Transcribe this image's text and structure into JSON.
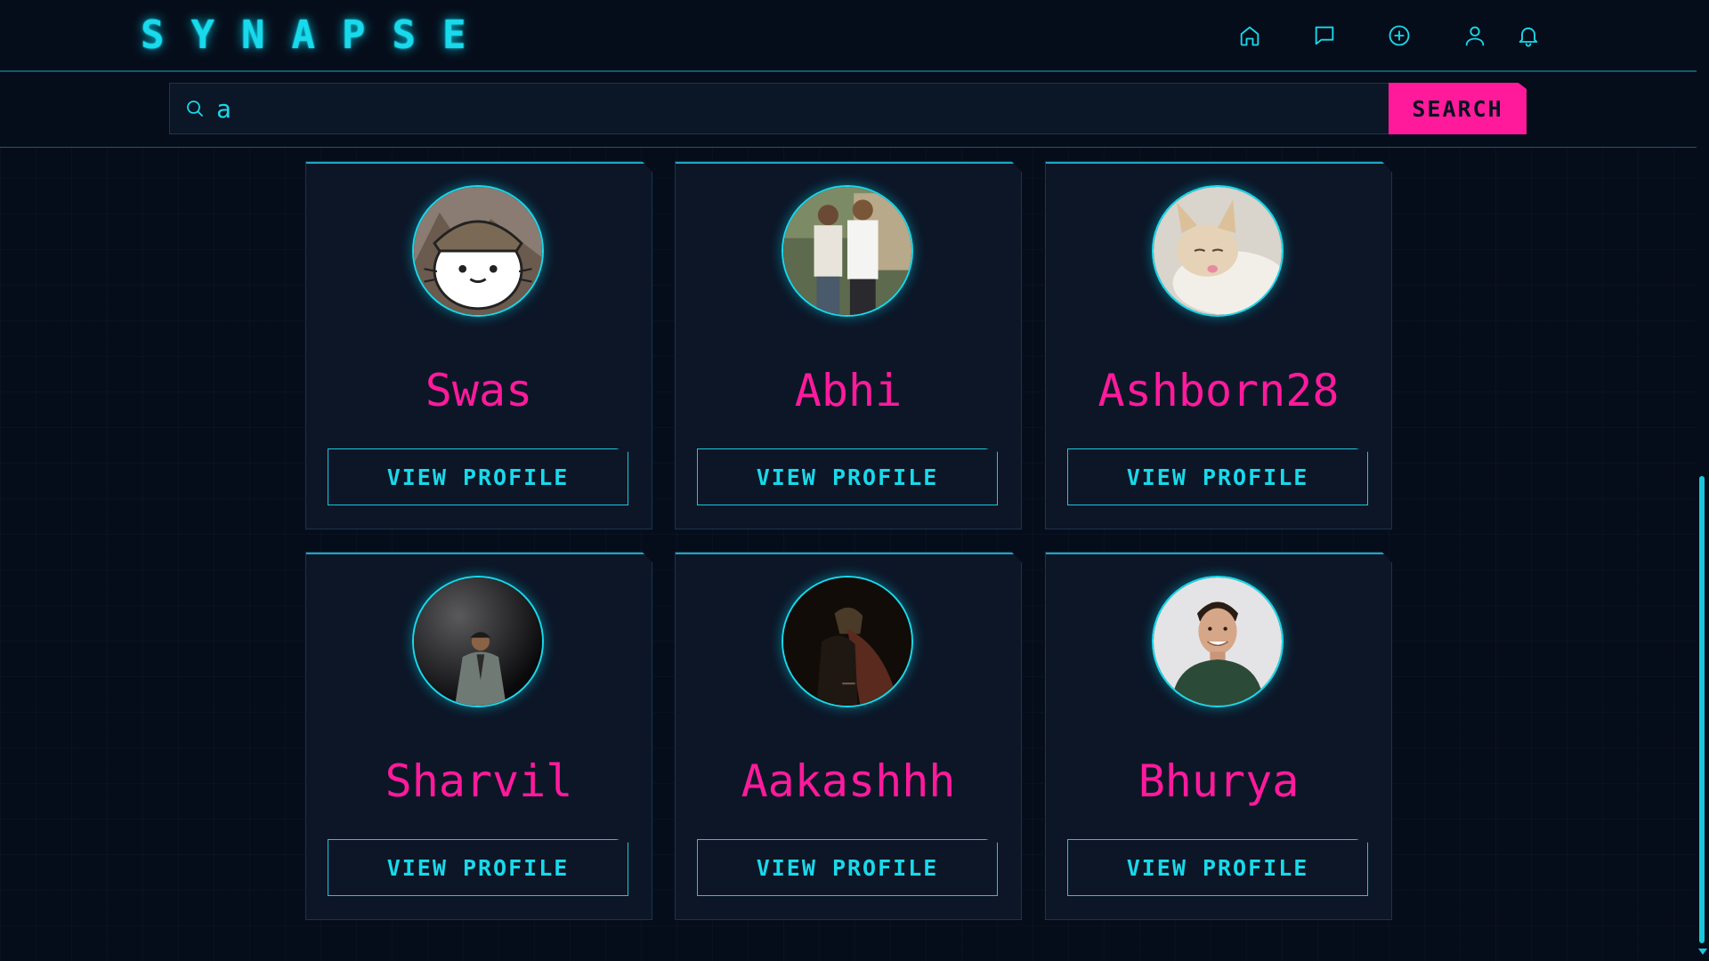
{
  "app": {
    "logo": "SYNAPSE"
  },
  "nav": [
    {
      "name": "home",
      "icon": "home-icon"
    },
    {
      "name": "messages",
      "icon": "chat-icon"
    },
    {
      "name": "create",
      "icon": "plus-circle-icon"
    },
    {
      "name": "profile",
      "icon": "user-icon"
    },
    {
      "name": "notifications",
      "icon": "bell-icon"
    }
  ],
  "search": {
    "value": "a",
    "button_label": "SEARCH"
  },
  "results": [
    {
      "name": "Swas",
      "avatar": "cartoon-cat-avatar",
      "button_label": "VIEW PROFILE"
    },
    {
      "name": "Abhi",
      "avatar": "two-people-photo-avatar",
      "button_label": "VIEW PROFILE"
    },
    {
      "name": "Ashborn28",
      "avatar": "kitten-photo-avatar",
      "button_label": "VIEW PROFILE"
    },
    {
      "name": "Sharvil",
      "avatar": "man-dark-photo-avatar",
      "button_label": "VIEW PROFILE"
    },
    {
      "name": "Aakashhh",
      "avatar": "dark-figure-photo-avatar",
      "button_label": "VIEW PROFILE"
    },
    {
      "name": "Bhurya",
      "avatar": "smiling-man-photo-avatar",
      "button_label": "VIEW PROFILE"
    }
  ],
  "colors": {
    "accent_cyan": "#19d9ea",
    "accent_pink": "#ff1a9c",
    "background": "#060d1a",
    "card": "#0c1627"
  }
}
